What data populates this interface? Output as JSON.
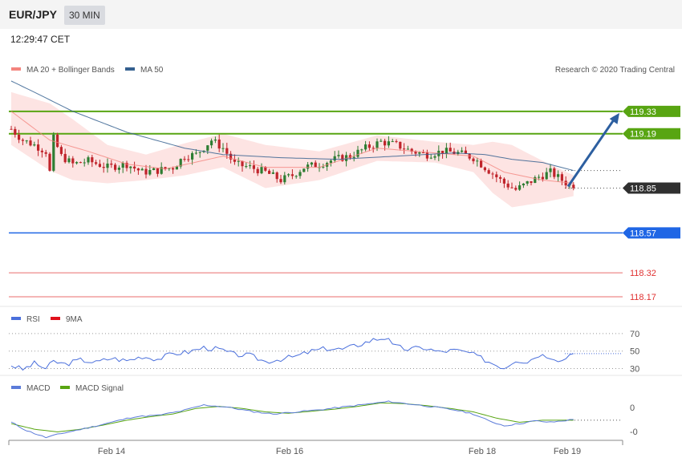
{
  "header": {
    "pair": "EUR/JPY",
    "timeframe": "30 MIN"
  },
  "timestamp": "12:29:47 CET",
  "copyright": "Research © 2020 Trading Central",
  "colors": {
    "bollinger": "#f4847e",
    "ma50": "#35608f",
    "up": "#2e7d32",
    "down": "#c0242b",
    "resistance": "#58a512",
    "support_strong": "#1f66e5",
    "support_weak": "#e03131",
    "current": "#303030",
    "rsi": "#4a6fdc",
    "rsi_ma": "#e0101b",
    "macd": "#5b7bd9",
    "macd_signal": "#58a512",
    "arrow": "#2d5fa0"
  },
  "chart_data": [
    {
      "type": "candlestick",
      "legend": [
        {
          "name": "MA 20 + Bollinger Bands",
          "color": "#f4847e"
        },
        {
          "name": "MA 50",
          "color": "#35608f"
        }
      ],
      "x_ticks": [
        "Feb 14",
        "Feb 16",
        "Feb 18",
        "Feb 19"
      ],
      "ylim": [
        118.12,
        119.55
      ],
      "levels": [
        {
          "value": 119.33,
          "label": "119.33",
          "kind": "resistance"
        },
        {
          "value": 119.19,
          "label": "119.19",
          "kind": "resistance"
        },
        {
          "value": 118.85,
          "label": "118.85",
          "kind": "current"
        },
        {
          "value": 118.57,
          "label": "118.57",
          "kind": "support_strong"
        },
        {
          "value": 118.32,
          "label": "118.32",
          "kind": "support_weak"
        },
        {
          "value": 118.17,
          "label": "118.17",
          "kind": "support_weak"
        }
      ],
      "anchors": [
        [
          0,
          119.22
        ],
        [
          3,
          119.15
        ],
        [
          6,
          119.12
        ],
        [
          9,
          119.08
        ],
        [
          10,
          118.95
        ],
        [
          11,
          119.16
        ],
        [
          13,
          119.05
        ],
        [
          16,
          119.0
        ],
        [
          20,
          119.02
        ],
        [
          25,
          118.98
        ],
        [
          30,
          119.0
        ],
        [
          34,
          118.95
        ],
        [
          38,
          118.96
        ],
        [
          42,
          118.98
        ],
        [
          45,
          119.05
        ],
        [
          48,
          119.06
        ],
        [
          52,
          119.15
        ],
        [
          55,
          119.1
        ],
        [
          58,
          119.0
        ],
        [
          62,
          118.98
        ],
        [
          66,
          118.95
        ],
        [
          70,
          118.9
        ],
        [
          73,
          118.93
        ],
        [
          76,
          118.98
        ],
        [
          80,
          119.0
        ],
        [
          84,
          119.03
        ],
        [
          88,
          119.05
        ],
        [
          92,
          119.1
        ],
        [
          96,
          119.14
        ],
        [
          100,
          119.12
        ],
        [
          104,
          119.08
        ],
        [
          108,
          119.06
        ],
        [
          112,
          119.08
        ],
        [
          116,
          119.07
        ],
        [
          120,
          119.04
        ],
        [
          123,
          118.98
        ],
        [
          126,
          118.92
        ],
        [
          128,
          118.88
        ],
        [
          131,
          118.84
        ],
        [
          134,
          118.88
        ],
        [
          137,
          118.92
        ],
        [
          140,
          118.95
        ],
        [
          143,
          118.9
        ],
        [
          146,
          118.85
        ]
      ],
      "ma20": [
        [
          0,
          119.33
        ],
        [
          10,
          119.15
        ],
        [
          20,
          119.08
        ],
        [
          30,
          119.0
        ],
        [
          40,
          118.97
        ],
        [
          55,
          119.05
        ],
        [
          66,
          118.98
        ],
        [
          80,
          118.98
        ],
        [
          95,
          119.1
        ],
        [
          110,
          119.07
        ],
        [
          120,
          119.05
        ],
        [
          128,
          118.95
        ],
        [
          138,
          118.9
        ],
        [
          146,
          118.88
        ]
      ],
      "bb_upper": [
        [
          0,
          119.45
        ],
        [
          10,
          119.38
        ],
        [
          16,
          119.28
        ],
        [
          25,
          119.12
        ],
        [
          35,
          119.06
        ],
        [
          45,
          119.13
        ],
        [
          55,
          119.19
        ],
        [
          66,
          119.12
        ],
        [
          80,
          119.08
        ],
        [
          95,
          119.18
        ],
        [
          110,
          119.14
        ],
        [
          120,
          119.12
        ],
        [
          125,
          119.14
        ],
        [
          130,
          119.12
        ],
        [
          138,
          119.02
        ],
        [
          146,
          118.93
        ]
      ],
      "bb_lower": [
        [
          0,
          119.12
        ],
        [
          10,
          118.96
        ],
        [
          16,
          118.9
        ],
        [
          25,
          118.88
        ],
        [
          35,
          118.9
        ],
        [
          45,
          118.93
        ],
        [
          55,
          118.98
        ],
        [
          66,
          118.85
        ],
        [
          80,
          118.9
        ],
        [
          95,
          119.02
        ],
        [
          110,
          119.01
        ],
        [
          120,
          118.95
        ],
        [
          125,
          118.82
        ],
        [
          130,
          118.73
        ],
        [
          138,
          118.76
        ],
        [
          146,
          118.8
        ]
      ],
      "ma50": [
        [
          0,
          119.52
        ],
        [
          6,
          119.45
        ],
        [
          16,
          119.33
        ],
        [
          30,
          119.2
        ],
        [
          45,
          119.1
        ],
        [
          55,
          119.06
        ],
        [
          70,
          119.04
        ],
        [
          85,
          119.03
        ],
        [
          100,
          119.05
        ],
        [
          115,
          119.07
        ],
        [
          123,
          119.06
        ],
        [
          130,
          119.03
        ],
        [
          138,
          119.01
        ],
        [
          146,
          118.96
        ]
      ],
      "forecast_arrow": {
        "from": 118.86,
        "to": 119.32
      }
    },
    {
      "type": "line",
      "legend": [
        {
          "name": "RSI",
          "color": "#4a6fdc"
        },
        {
          "name": "9MA",
          "color": "#e0101b"
        }
      ],
      "y_ticks": [
        70,
        50,
        30
      ],
      "ylim": [
        25,
        80
      ],
      "rsi": [
        [
          0,
          34
        ],
        [
          3,
          29
        ],
        [
          6,
          36
        ],
        [
          9,
          30
        ],
        [
          11,
          38
        ],
        [
          14,
          35
        ],
        [
          18,
          40
        ],
        [
          22,
          37
        ],
        [
          26,
          42
        ],
        [
          30,
          39
        ],
        [
          34,
          44
        ],
        [
          38,
          41
        ],
        [
          42,
          47
        ],
        [
          46,
          49
        ],
        [
          50,
          54
        ],
        [
          54,
          52
        ],
        [
          58,
          46
        ],
        [
          62,
          45
        ],
        [
          66,
          38
        ],
        [
          70,
          41
        ],
        [
          74,
          44
        ],
        [
          78,
          50
        ],
        [
          82,
          53
        ],
        [
          86,
          52
        ],
        [
          90,
          57
        ],
        [
          94,
          63
        ],
        [
          98,
          66
        ],
        [
          99,
          56
        ],
        [
          103,
          52
        ],
        [
          107,
          54
        ],
        [
          111,
          49
        ],
        [
          115,
          51
        ],
        [
          119,
          48
        ],
        [
          122,
          42
        ],
        [
          125,
          36
        ],
        [
          128,
          31
        ],
        [
          131,
          40
        ],
        [
          134,
          38
        ],
        [
          137,
          46
        ],
        [
          140,
          44
        ],
        [
          143,
          39
        ],
        [
          146,
          50
        ]
      ]
    },
    {
      "type": "line",
      "legend": [
        {
          "name": "MACD",
          "color": "#5b7bd9"
        },
        {
          "name": "MACD Signal",
          "color": "#58a512"
        }
      ],
      "y_ticks": [
        "0",
        "-0"
      ],
      "macd": [
        [
          0,
          -0.2
        ],
        [
          4,
          -0.32
        ],
        [
          9,
          -0.42
        ],
        [
          14,
          -0.35
        ],
        [
          20,
          -0.28
        ],
        [
          26,
          -0.2
        ],
        [
          32,
          -0.12
        ],
        [
          38,
          -0.1
        ],
        [
          44,
          -0.04
        ],
        [
          50,
          0.05
        ],
        [
          56,
          0.02
        ],
        [
          62,
          -0.04
        ],
        [
          68,
          -0.08
        ],
        [
          74,
          -0.05
        ],
        [
          80,
          -0.02
        ],
        [
          86,
          0.02
        ],
        [
          92,
          0.06
        ],
        [
          98,
          0.1
        ],
        [
          104,
          0.06
        ],
        [
          110,
          0.02
        ],
        [
          116,
          -0.03
        ],
        [
          120,
          -0.08
        ],
        [
          124,
          -0.18
        ],
        [
          128,
          -0.25
        ],
        [
          132,
          -0.22
        ],
        [
          136,
          -0.18
        ],
        [
          140,
          -0.2
        ],
        [
          146,
          -0.16
        ]
      ],
      "signal": [
        [
          0,
          -0.22
        ],
        [
          6,
          -0.3
        ],
        [
          12,
          -0.34
        ],
        [
          18,
          -0.3
        ],
        [
          24,
          -0.24
        ],
        [
          30,
          -0.17
        ],
        [
          36,
          -0.12
        ],
        [
          42,
          -0.08
        ],
        [
          48,
          0.0
        ],
        [
          54,
          0.03
        ],
        [
          60,
          0.0
        ],
        [
          66,
          -0.05
        ],
        [
          72,
          -0.07
        ],
        [
          78,
          -0.04
        ],
        [
          84,
          -0.01
        ],
        [
          90,
          0.03
        ],
        [
          96,
          0.08
        ],
        [
          102,
          0.07
        ],
        [
          108,
          0.04
        ],
        [
          114,
          0.0
        ],
        [
          120,
          -0.05
        ],
        [
          126,
          -0.14
        ],
        [
          132,
          -0.2
        ],
        [
          138,
          -0.17
        ],
        [
          146,
          -0.17
        ]
      ]
    }
  ]
}
